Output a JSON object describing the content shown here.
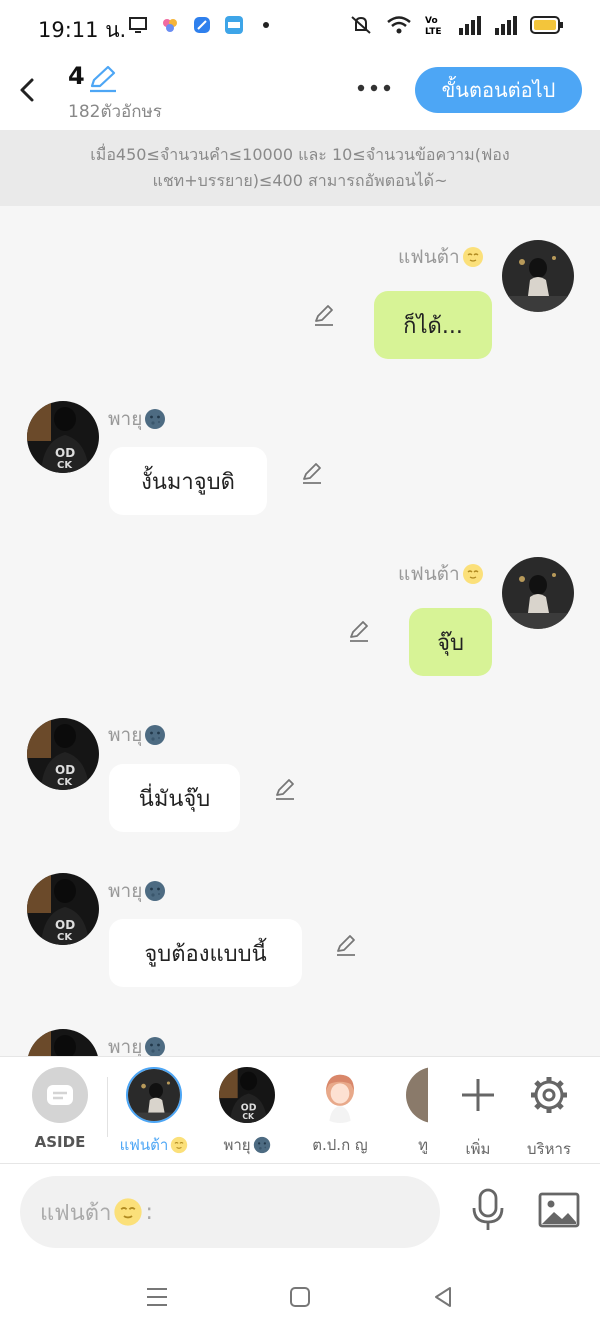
{
  "status_bar": {
    "time": "19:11 น.",
    "icons": [
      "screen-icon",
      "app-icon",
      "app-icon",
      "noveltoon-icon",
      "dot-icon",
      "mute-icon",
      "wifi-icon",
      "volte-icon",
      "signal-icon",
      "signal-icon",
      "battery-icon"
    ]
  },
  "header": {
    "episode": "4",
    "char_count": "182ตัวอักษร",
    "next_label": "ขั้นตอนต่อไป"
  },
  "notice": "เมื่อ450≤จำนวนคำ≤10000 และ 10≤จำนวนข้อความ(ฟองแชท+บรรยาย)≤400 สามารถอัพตอนได้~",
  "messages": [
    {
      "sender": "แฟนต้า",
      "side": "right",
      "text": "ก็ได้..."
    },
    {
      "sender": "พายุ",
      "side": "left",
      "text": "งั้นมาจูบดิ"
    },
    {
      "sender": "แฟนต้า",
      "side": "right",
      "text": "จุ๊บ"
    },
    {
      "sender": "พายุ",
      "side": "left",
      "text": "นี่มันจุ๊บ"
    },
    {
      "sender": "พายุ",
      "side": "left",
      "text": "จูบต้องแบบนี้"
    },
    {
      "sender": "พายุ",
      "side": "left",
      "text": ""
    }
  ],
  "characters": [
    {
      "label": "ASIDE"
    },
    {
      "label": "แฟนต้า"
    },
    {
      "label": "พายุ"
    },
    {
      "label": "ต.ป.ก ญ"
    },
    {
      "label": "ทู"
    }
  ],
  "actions": {
    "add_label": "เพิ่ม",
    "manage_label": "บริหาร"
  },
  "input": {
    "placeholder": "แฟนต้า",
    "suffix": ":"
  },
  "colors": {
    "accent": "#4da6f5",
    "my_bubble": "#d7f396",
    "other_bubble": "#ffffff"
  }
}
